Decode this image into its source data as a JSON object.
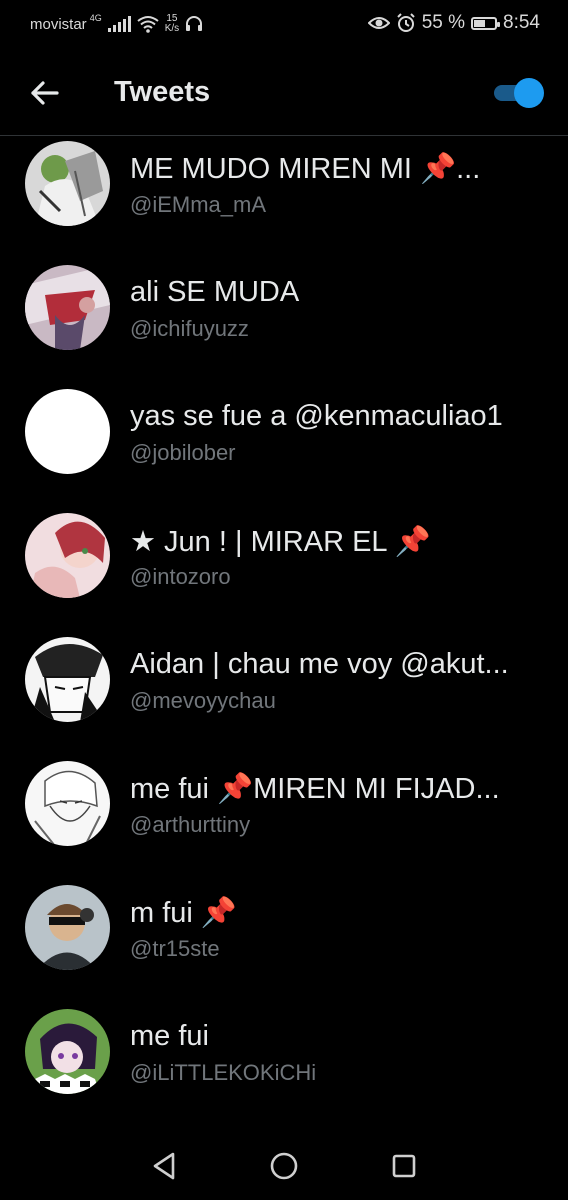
{
  "status_bar": {
    "carrier": "movistar",
    "network": "4G",
    "speed_value": "15",
    "speed_unit": "K/s",
    "battery": "55 %",
    "battery_level": 0.55,
    "time": "8:54"
  },
  "header": {
    "title": "Tweets",
    "toggle_on": true,
    "accent": "#1d9bf0"
  },
  "accounts": [
    {
      "name": "ME MUDO MIREN MI 📌...",
      "handle": "@iEMma_mA",
      "avatar": "manga-gray"
    },
    {
      "name": "ali SE MUDA",
      "handle": "@ichifuyuzz",
      "avatar": "anime-red"
    },
    {
      "name": "yas se fue a @kenmaculiao1",
      "handle": "@jobilober",
      "avatar": "blank-white"
    },
    {
      "name": "★ Jun ! | MIRAR EL 📌",
      "handle": "@intozoro",
      "avatar": "anime-redhair"
    },
    {
      "name": "Aidan | chau me voy @akut...",
      "handle": "@mevoyychau",
      "avatar": "manga-bw"
    },
    {
      "name": "me fui 📌MIREN MI FIJAD...",
      "handle": "@arthurttiny",
      "avatar": "manga-sketch"
    },
    {
      "name": "m fui 📌",
      "handle": "@tr15ste",
      "avatar": "anime-headphones"
    },
    {
      "name": "me fui",
      "handle": "@iLiTTLEKOKiCHi",
      "avatar": "anime-purple"
    }
  ],
  "nav": {
    "back": "back-icon",
    "home": "home-icon",
    "recents": "recents-icon"
  }
}
